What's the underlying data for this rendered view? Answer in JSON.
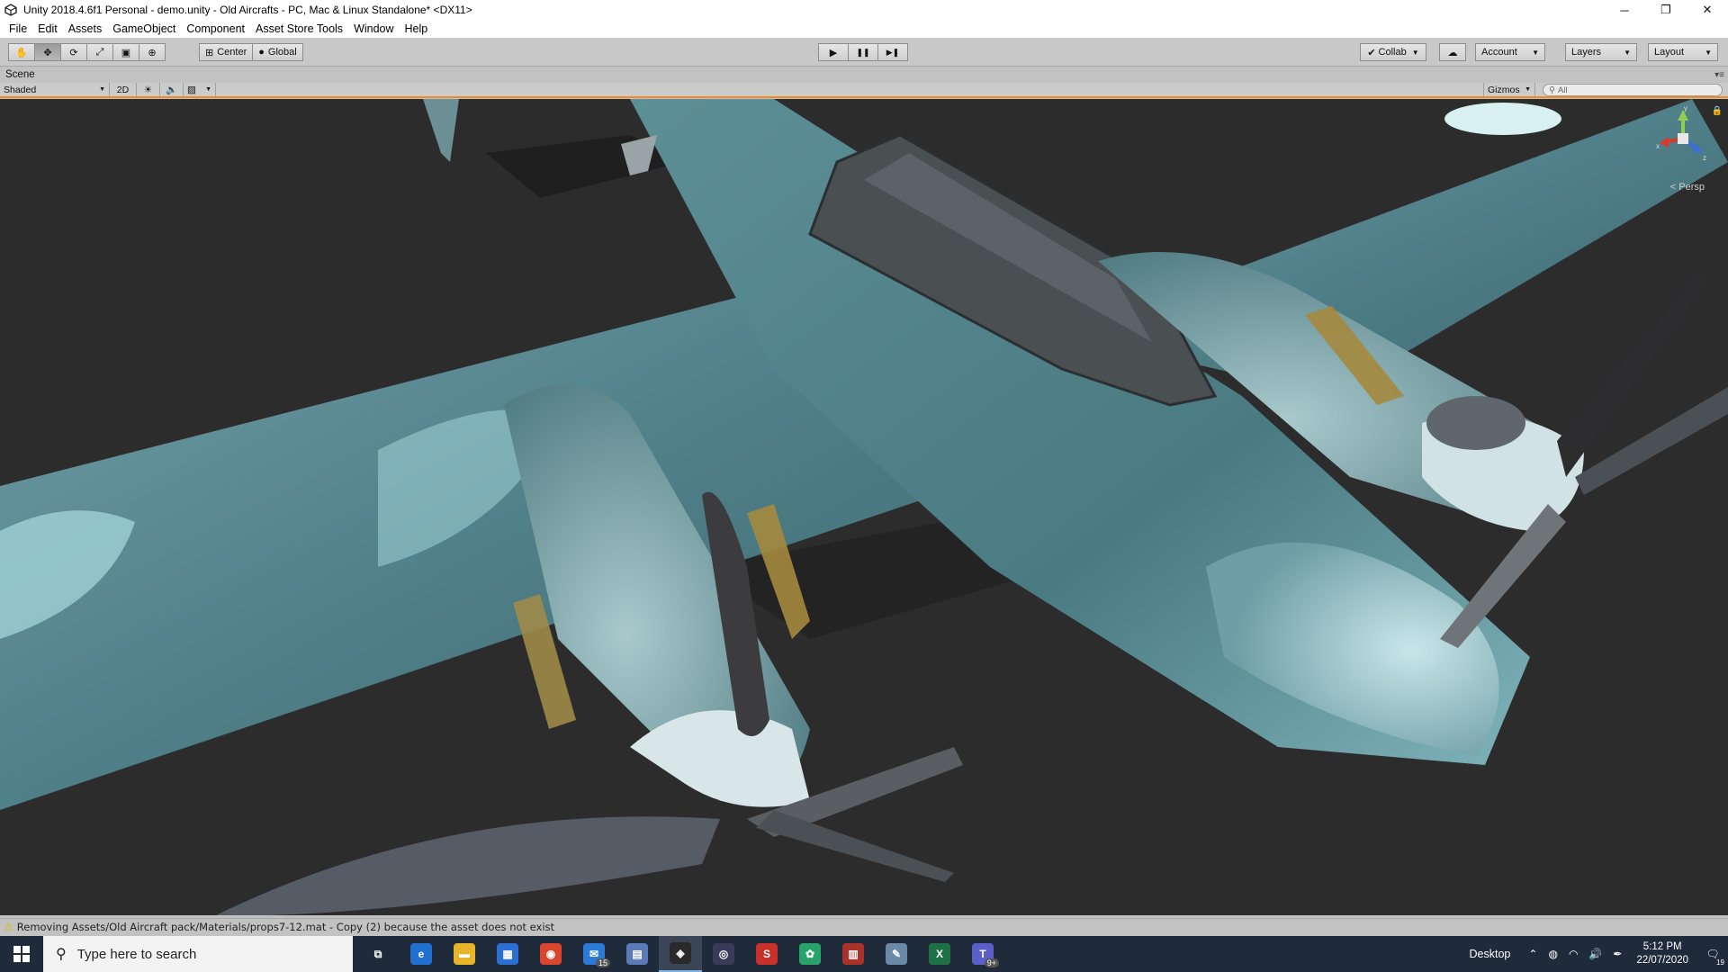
{
  "window": {
    "title": "Unity 2018.4.6f1 Personal - demo.unity - Old Aircrafts - PC, Mac & Linux Standalone* <DX11>",
    "minimize": "─",
    "restore": "❐",
    "close": "✕"
  },
  "menu": [
    "File",
    "Edit",
    "Assets",
    "GameObject",
    "Component",
    "Asset Store Tools",
    "Window",
    "Help"
  ],
  "toolbar": {
    "tools": [
      "hand-tool",
      "move-tool",
      "rotate-tool",
      "scale-tool",
      "rect-tool",
      "transform-tool"
    ],
    "pivot_label": "Center",
    "space_label": "Global",
    "play_label": "▶",
    "pause_label": "❚❚",
    "step_label": "▶❚",
    "collab_label": "Collab",
    "cloud_label": "☁",
    "account_label": "Account",
    "layers_label": "Layers",
    "layout_label": "Layout"
  },
  "scene": {
    "tab_label": "Scene",
    "shading_mode": "Shaded",
    "mode_2d": "2D",
    "gizmos_label": "Gizmos",
    "search_placeholder": "All",
    "persp_label": "< Persp",
    "axis_x": "x",
    "axis_y": "y",
    "axis_z": "z"
  },
  "status": {
    "message": "Removing Assets/Old Aircraft pack/Materials/props7-12.mat - Copy (2) because the asset does not exist"
  },
  "taskbar": {
    "search_placeholder": "Type here to search",
    "apps": [
      {
        "name": "task-view",
        "glyph": "⧉",
        "color": "#1f2a3a"
      },
      {
        "name": "edge",
        "glyph": "e",
        "color": "#1f6fd1"
      },
      {
        "name": "file-explorer",
        "glyph": "▬",
        "color": "#e8b52a"
      },
      {
        "name": "store",
        "glyph": "▦",
        "color": "#2a6fd1"
      },
      {
        "name": "chrome",
        "glyph": "◉",
        "color": "#d9452f"
      },
      {
        "name": "mail",
        "glyph": "✉",
        "color": "#2b7bd6",
        "badge": "15"
      },
      {
        "name": "app-window",
        "glyph": "▤",
        "color": "#5a7ab8"
      },
      {
        "name": "unity",
        "glyph": "◈",
        "color": "#2a2a2a",
        "active": true
      },
      {
        "name": "obs",
        "glyph": "◎",
        "color": "#3a3a5a"
      },
      {
        "name": "substance",
        "glyph": "S",
        "color": "#c8302a"
      },
      {
        "name": "colors-app",
        "glyph": "✿",
        "color": "#2aa36a"
      },
      {
        "name": "archive-app",
        "glyph": "▥",
        "color": "#a8322a"
      },
      {
        "name": "paint-app",
        "glyph": "✎",
        "color": "#6a8aa8"
      },
      {
        "name": "excel",
        "glyph": "X",
        "color": "#1e7145"
      },
      {
        "name": "teams",
        "glyph": "T",
        "color": "#5b5fc7",
        "badge": "9+"
      }
    ],
    "desktop_label": "Desktop",
    "time": "5:12 PM",
    "date": "22/07/2020",
    "notif_count": "19"
  }
}
